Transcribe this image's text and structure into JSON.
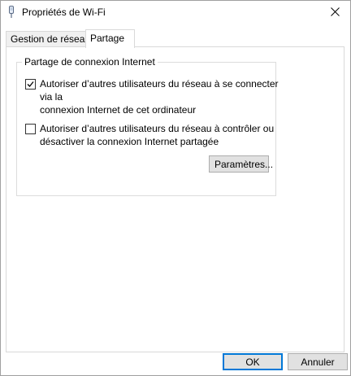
{
  "window": {
    "title": "Propriétés de Wi-Fi",
    "close_icon": "close-icon",
    "app_icon": "wifi-adapter-icon"
  },
  "tabs": [
    {
      "label": "Gestion de réseau",
      "selected": false
    },
    {
      "label": "Partage",
      "selected": true
    }
  ],
  "sharing": {
    "group_title": "Partage de connexion Internet",
    "option1": {
      "checked": true,
      "line1": "Autoriser d’autres utilisateurs du réseau à se connecter via la",
      "line2": "connexion Internet de cet ordinateur"
    },
    "option2": {
      "checked": false,
      "line1": "Autoriser d’autres utilisateurs du réseau à contrôler ou",
      "line2": "désactiver la connexion Internet partagée"
    },
    "settings_button": "Paramètres..."
  },
  "footer": {
    "ok_label": "OK",
    "cancel_label": "Annuler"
  },
  "colors": {
    "accent": "#0078d7",
    "button_bg": "#e1e1e1",
    "border": "#adadad"
  }
}
